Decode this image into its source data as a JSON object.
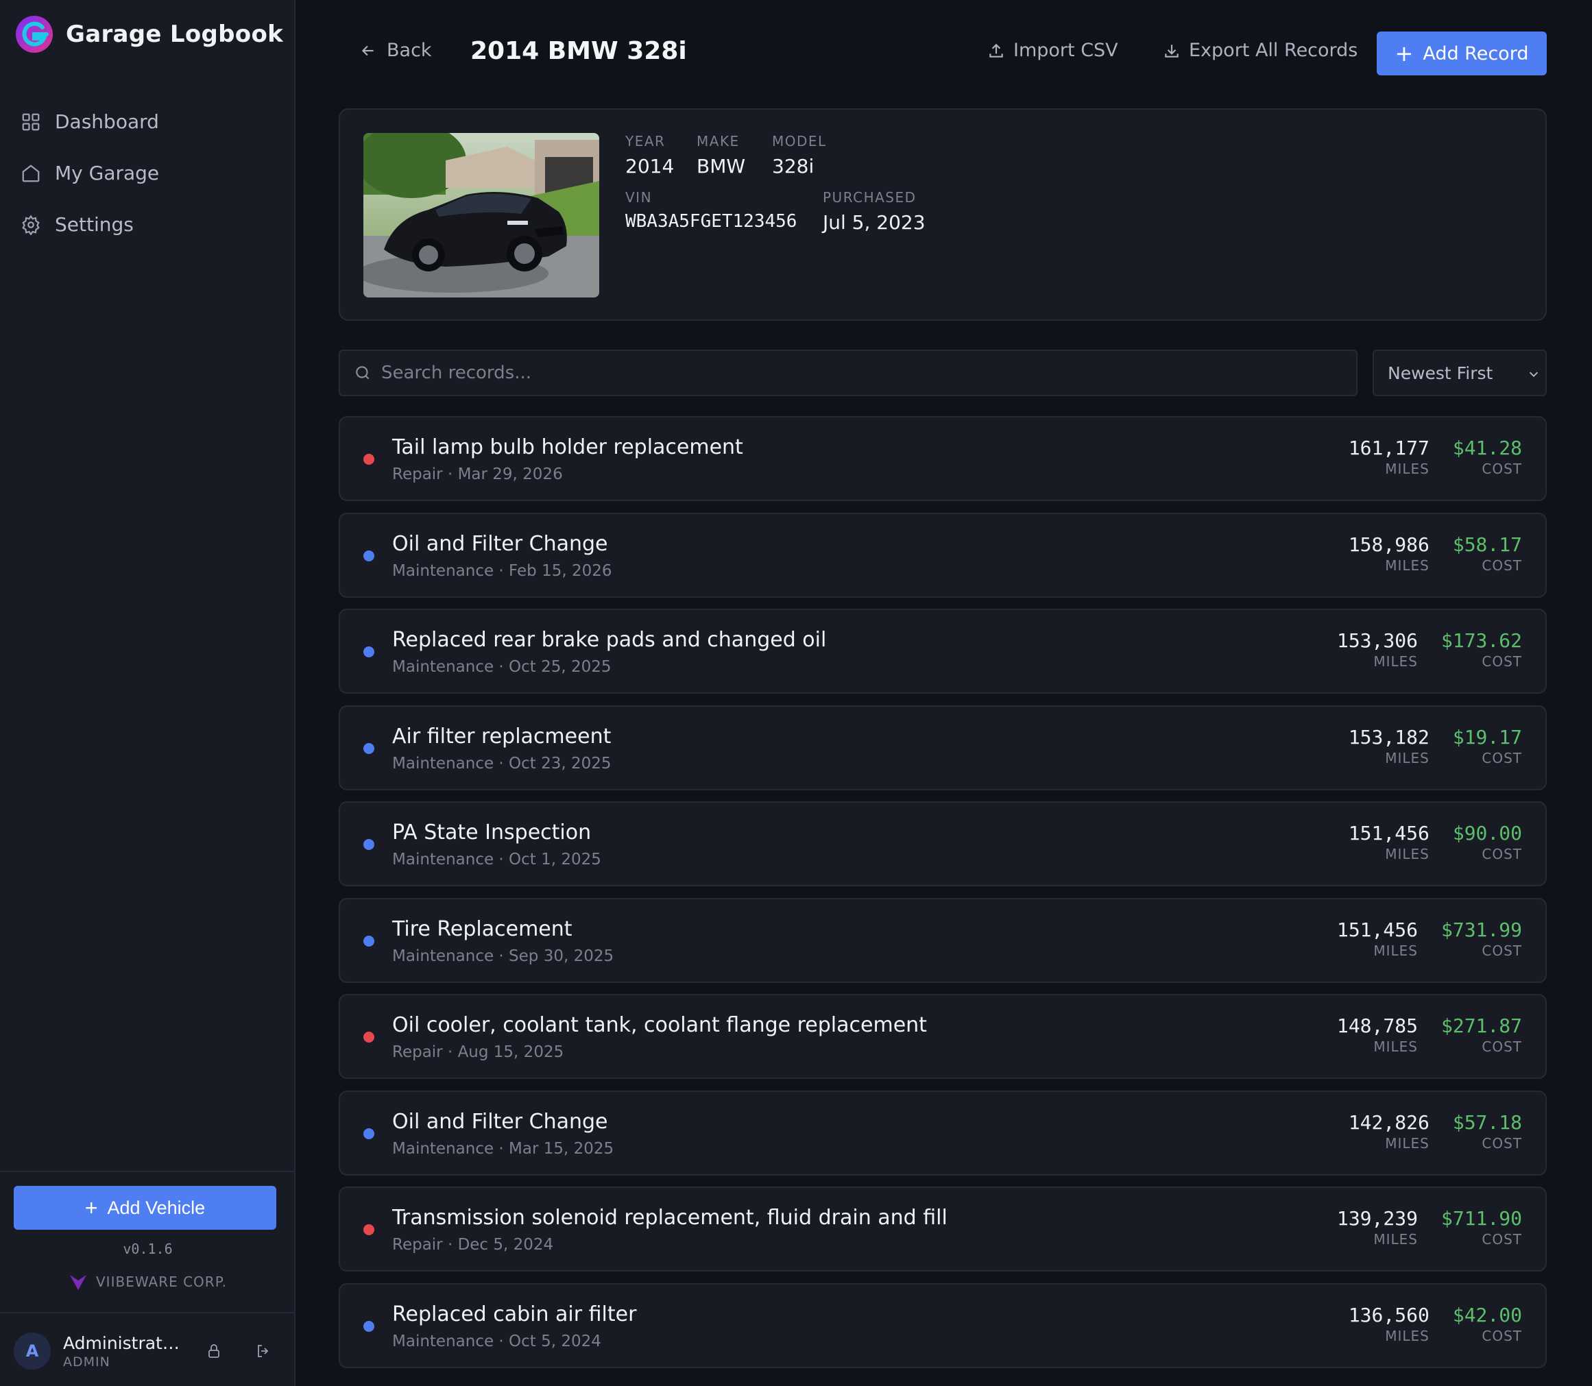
{
  "app": {
    "name": "Garage Logbook",
    "version": "v0.1.6",
    "vendor": "VIIBEWARE CORP."
  },
  "sidebar": {
    "items": [
      {
        "label": "Dashboard",
        "icon": "grid-icon"
      },
      {
        "label": "My Garage",
        "icon": "home-icon"
      },
      {
        "label": "Settings",
        "icon": "gear-icon"
      }
    ],
    "add_vehicle_label": "Add Vehicle"
  },
  "user": {
    "initial": "A",
    "name": "Administrator",
    "role": "ADMIN"
  },
  "header": {
    "back_label": "Back",
    "title": "2014 BMW 328i",
    "import_label": "Import CSV",
    "export_label": "Export All Records",
    "add_record_label": "Add Record"
  },
  "vehicle": {
    "year_label": "YEAR",
    "year": "2014",
    "make_label": "MAKE",
    "make": "BMW",
    "model_label": "MODEL",
    "model": "328i",
    "vin_label": "VIN",
    "vin": "WBA3A5FGET123456",
    "purchased_label": "PURCHASED",
    "purchased": "Jul 5, 2023"
  },
  "search": {
    "placeholder": "Search records..."
  },
  "sort": {
    "selected": "Newest First"
  },
  "labels": {
    "miles": "MILES",
    "cost": "COST"
  },
  "colors": {
    "accent": "#4f7ef2",
    "repair": "#e5484d",
    "maintenance": "#4f7ef2",
    "cost": "#5bbf6b"
  },
  "records": [
    {
      "title": "Tail lamp bulb holder replacement",
      "meta": "Repair · Mar 29, 2026",
      "type": "repair",
      "miles": "161,177",
      "cost": "$41.28"
    },
    {
      "title": "Oil and Filter Change",
      "meta": "Maintenance · Feb 15, 2026",
      "type": "maintenance",
      "miles": "158,986",
      "cost": "$58.17"
    },
    {
      "title": "Replaced rear brake pads and changed oil",
      "meta": "Maintenance · Oct 25, 2025",
      "type": "maintenance",
      "miles": "153,306",
      "cost": "$173.62"
    },
    {
      "title": "Air filter replacmeent",
      "meta": "Maintenance · Oct 23, 2025",
      "type": "maintenance",
      "miles": "153,182",
      "cost": "$19.17"
    },
    {
      "title": "PA State Inspection",
      "meta": "Maintenance · Oct 1, 2025",
      "type": "maintenance",
      "miles": "151,456",
      "cost": "$90.00"
    },
    {
      "title": "Tire Replacement",
      "meta": "Maintenance · Sep 30, 2025",
      "type": "maintenance",
      "miles": "151,456",
      "cost": "$731.99"
    },
    {
      "title": "Oil cooler, coolant tank, coolant flange replacement",
      "meta": "Repair · Aug 15, 2025",
      "type": "repair",
      "miles": "148,785",
      "cost": "$271.87"
    },
    {
      "title": "Oil and Filter Change",
      "meta": "Maintenance · Mar 15, 2025",
      "type": "maintenance",
      "miles": "142,826",
      "cost": "$57.18"
    },
    {
      "title": "Transmission solenoid replacement, fluid drain and fill",
      "meta": "Repair · Dec 5, 2024",
      "type": "repair",
      "miles": "139,239",
      "cost": "$711.90"
    },
    {
      "title": "Replaced cabin air filter",
      "meta": "Maintenance · Oct 5, 2024",
      "type": "maintenance",
      "miles": "136,560",
      "cost": "$42.00"
    }
  ]
}
